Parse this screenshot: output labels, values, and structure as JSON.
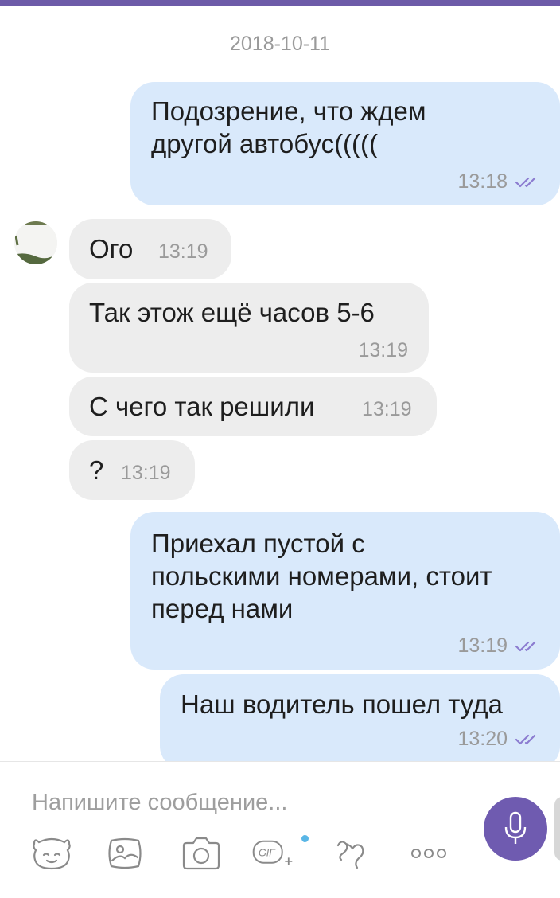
{
  "date_separator": "2018-10-11",
  "messages": [
    {
      "direction": "outgoing",
      "text": "Подозрение, что ждем\nдругой автобус(((((",
      "time": "13:18",
      "status": "read"
    },
    {
      "direction": "incoming",
      "text": "Ого",
      "time": "13:19"
    },
    {
      "direction": "incoming",
      "text": "Так этож ещё часов 5-6",
      "time": "13:19"
    },
    {
      "direction": "incoming",
      "text": "С чего так решили",
      "time": "13:19"
    },
    {
      "direction": "incoming",
      "text": "?",
      "time": "13:19"
    },
    {
      "direction": "outgoing",
      "text": "Приехал пустой с\nпольскими номерами, стоит\nперед нами",
      "time": "13:19",
      "status": "read"
    },
    {
      "direction": "outgoing",
      "text": "Наш водитель пошел туда",
      "time": "13:20",
      "status": "read"
    }
  ],
  "composer": {
    "placeholder": "Напишите сообщение...",
    "tools": [
      "sticker-icon",
      "gallery-icon",
      "camera-icon",
      "gif-icon",
      "doodle-icon",
      "more-icon"
    ]
  },
  "colors": {
    "accent": "#6f5bb0",
    "outgoing_bubble": "#d9e9fb",
    "incoming_bubble": "#ededed",
    "read_ticks": "#8c7cd0"
  }
}
